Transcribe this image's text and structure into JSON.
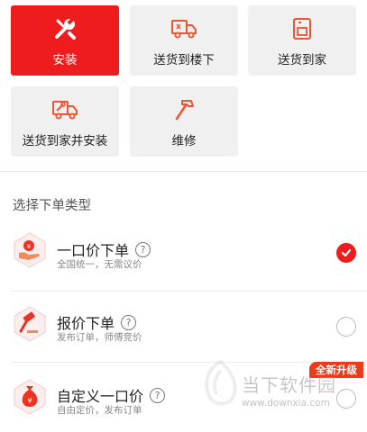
{
  "service_tiles": [
    {
      "label": "安装",
      "icon": "wrench-icon",
      "selected": true
    },
    {
      "label": "送货到楼下",
      "icon": "truck-icon",
      "selected": false
    },
    {
      "label": "送货到家",
      "icon": "door-icon",
      "selected": false
    },
    {
      "label": "送货到家并安装",
      "icon": "truck-wrench-icon",
      "selected": false
    },
    {
      "label": "维修",
      "icon": "hammer-icon",
      "selected": false
    }
  ],
  "section_title": "选择下单类型",
  "order_types": [
    {
      "name": "一口价下单",
      "help": "?",
      "desc": "全国统一，无需议价",
      "selected": true
    },
    {
      "name": "报价下单",
      "help": "?",
      "desc": "发布订单，师傅竞价",
      "selected": false
    },
    {
      "name": "自定义一口价",
      "help": "?",
      "desc": "自由定价，发布订单",
      "selected": false
    }
  ],
  "badge": "全新升级",
  "watermark": {
    "text": "当下软件园",
    "url": "www.downxia.com"
  },
  "colors": {
    "accent": "#ee1c1c",
    "tile_bg": "#f0f0f0"
  }
}
